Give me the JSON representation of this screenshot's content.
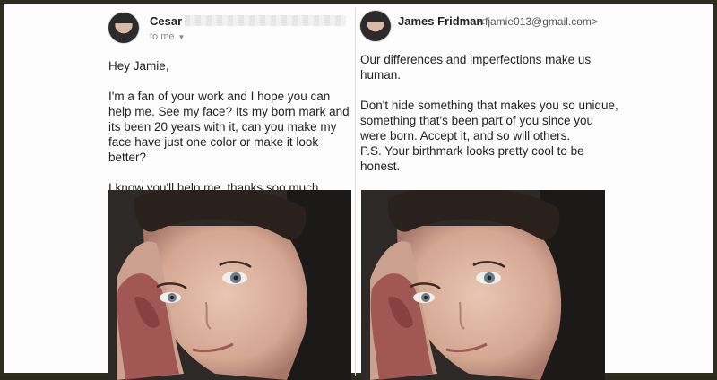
{
  "left_email": {
    "sender": "Cesar",
    "recipient_line": "to me",
    "greeting": "Hey Jamie,",
    "paragraph1": "I'm a fan of your work and I hope you can help me. See my face? Its my born mark and its been 20 years with it, can you make my face have just one color or make it look better?",
    "paragraph2": "I know you'll help me, thanks soo much.",
    "avatar_icon": "user-avatar-icon"
  },
  "right_email": {
    "sender": "James Fridman",
    "email": "<fjamie013@gmail.com>",
    "paragraph1": "Our differences and imperfections make us human.",
    "paragraph2": "Don't hide something that makes you so unique, something that's been part of you since you were born. Accept it, and so will others.",
    "ps": "P.S. Your birthmark looks pretty cool to be honest.",
    "avatar_icon": "user-avatar-icon"
  },
  "colors": {
    "frame": "#2e2c1e",
    "background": "#fdfdfd",
    "text": "#222222",
    "muted": "#888888"
  }
}
